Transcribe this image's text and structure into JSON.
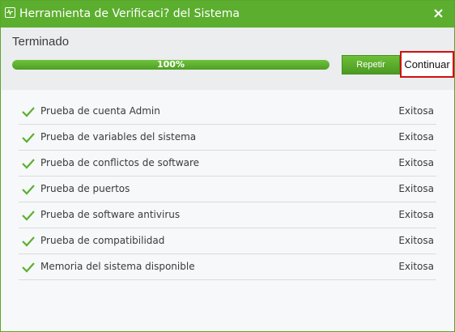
{
  "window": {
    "title": "Herramienta de Verificaci? del Sistema"
  },
  "header": {
    "status_title": "Terminado",
    "progress_percent": 100,
    "progress_label": "100%",
    "repeat_label": "Repetir",
    "continue_label": "Continuar"
  },
  "results": [
    {
      "name": "Prueba de cuenta Admin",
      "status": "Exitosa"
    },
    {
      "name": "Prueba de variables del sistema",
      "status": "Exitosa"
    },
    {
      "name": "Prueba de conflictos de software",
      "status": "Exitosa"
    },
    {
      "name": "Prueba de puertos",
      "status": "Exitosa"
    },
    {
      "name": "Prueba de software antivirus",
      "status": "Exitosa"
    },
    {
      "name": "Prueba de compatibilidad",
      "status": "Exitosa"
    },
    {
      "name": "Memoria del sistema disponible",
      "status": "Exitosa"
    }
  ],
  "icons": {
    "app": "system-check-icon",
    "close": "close-icon",
    "row": "checkmark-icon"
  },
  "colors": {
    "accent": "#5cae2e",
    "highlight_border": "#d01010",
    "check": "#5cb030"
  }
}
